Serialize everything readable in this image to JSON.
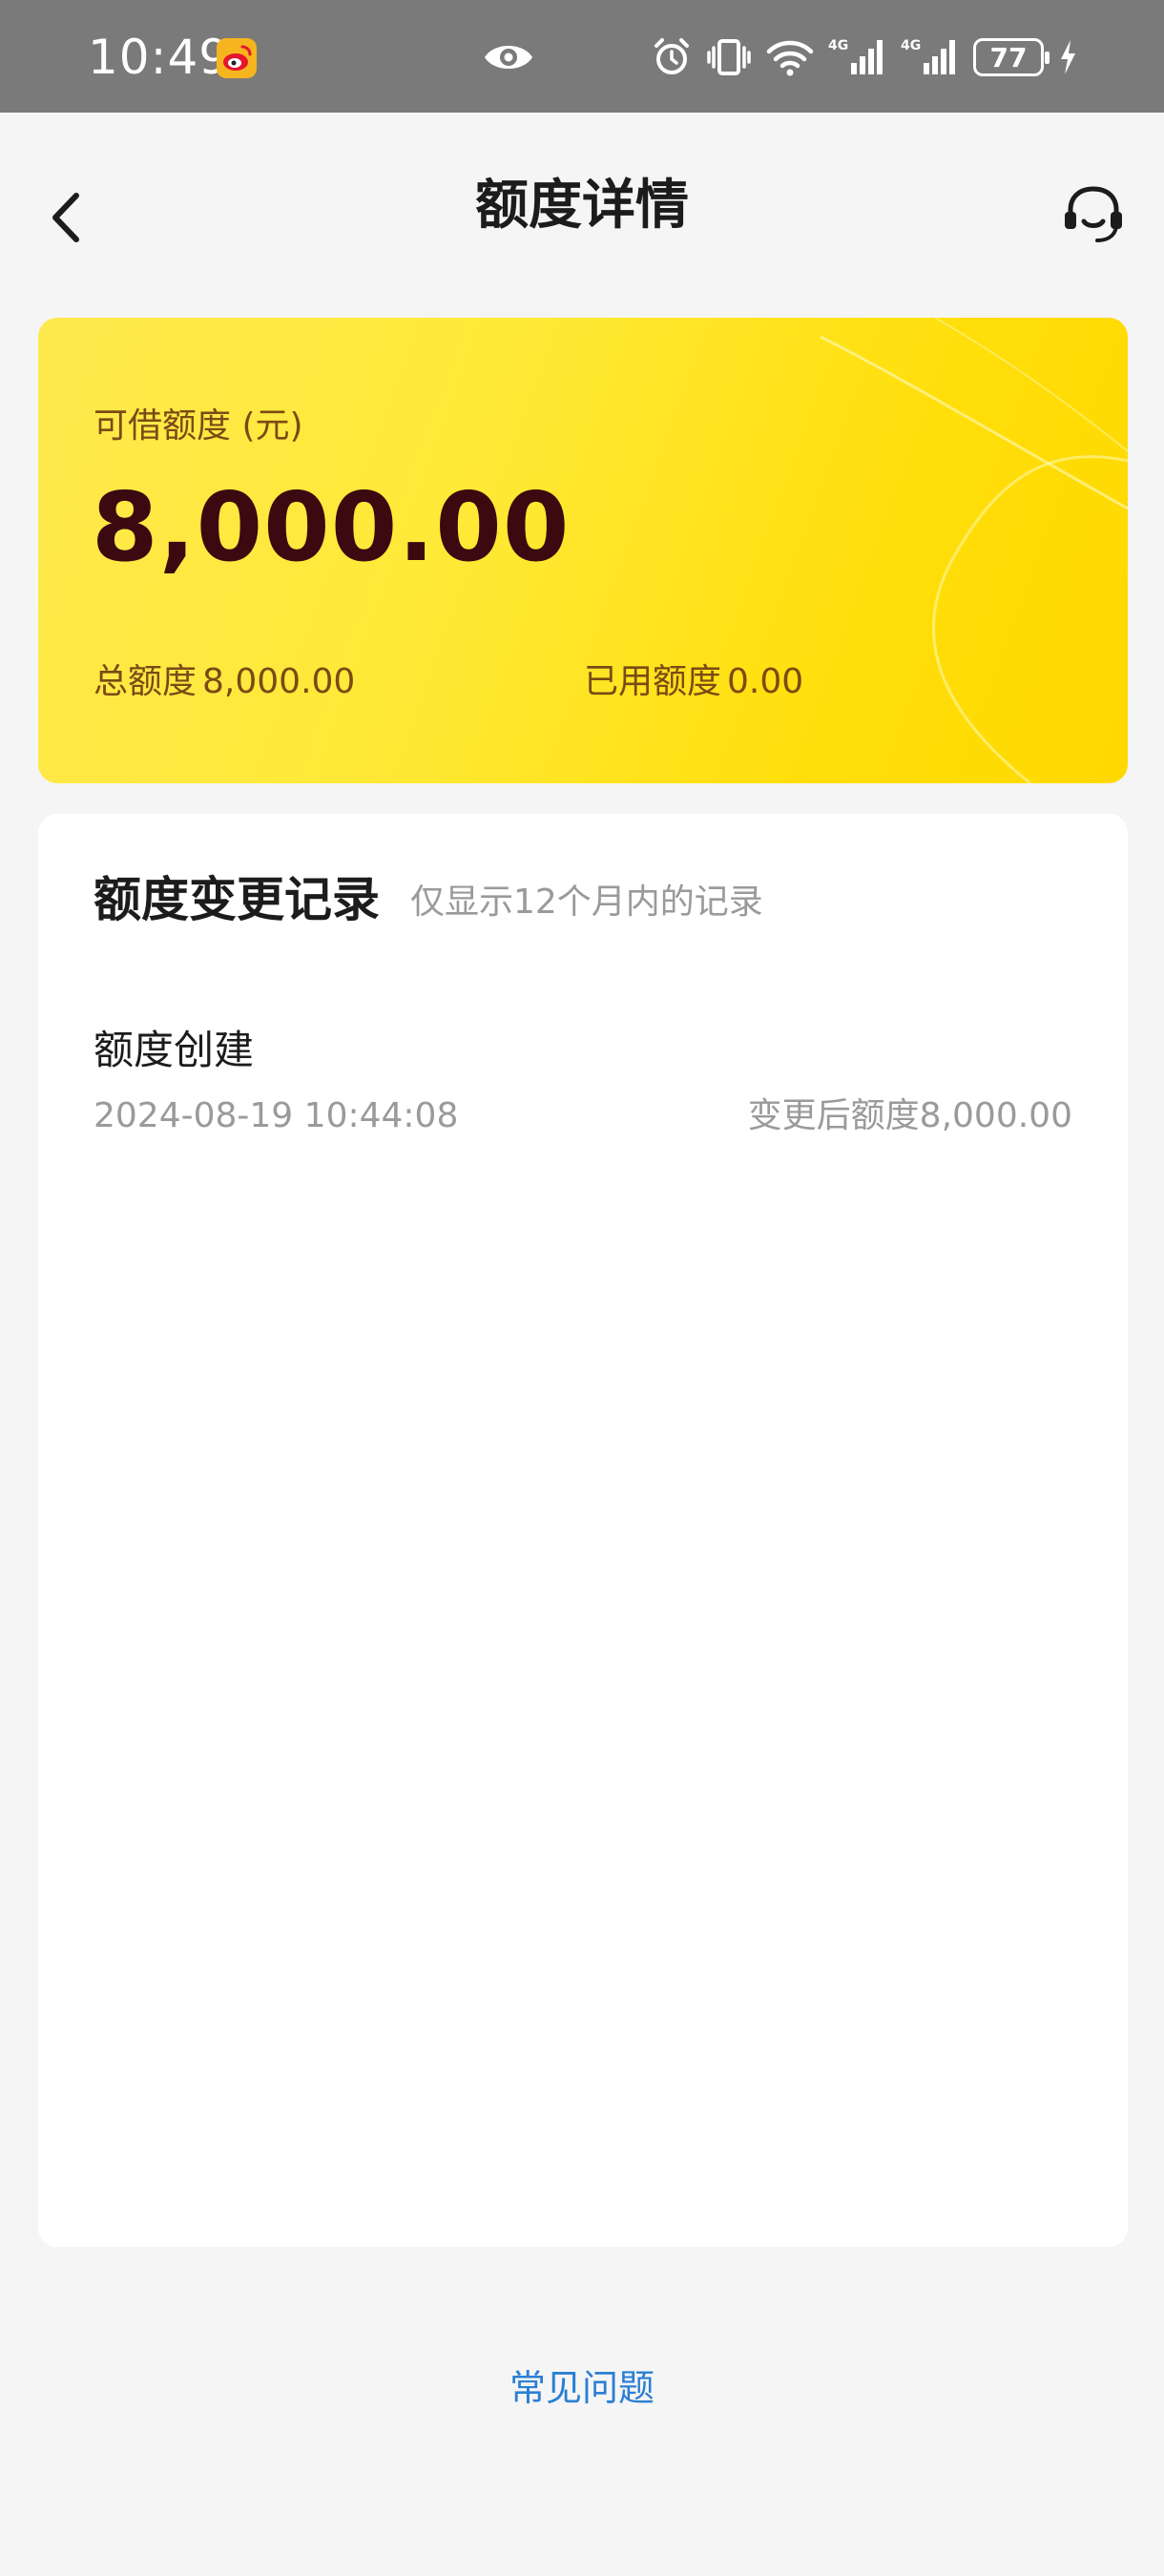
{
  "status_bar": {
    "time": "10:49",
    "battery": "77",
    "network_1": "4G",
    "network_2": "4G"
  },
  "header": {
    "title": "额度详情"
  },
  "credit_card": {
    "label": "可借额度 (元)",
    "available": "8,000.00",
    "total_label": "总额度",
    "total_value": "8,000.00",
    "used_label": "已用额度",
    "used_value": "0.00"
  },
  "records": {
    "title": "额度变更记录",
    "note": "仅显示12个月内的记录",
    "items": [
      {
        "type": "额度创建",
        "time": "2024-08-19 10:44:08",
        "after": "变更后额度8,000.00"
      }
    ]
  },
  "footer": {
    "faq": "常见问题"
  },
  "colors": {
    "card_yellow": "#ffe936",
    "amount_dark": "#3a0a10",
    "label_brown": "#7a4a14",
    "link_blue": "#2b7fd4",
    "status_bar_gray": "#7a7a7a"
  }
}
